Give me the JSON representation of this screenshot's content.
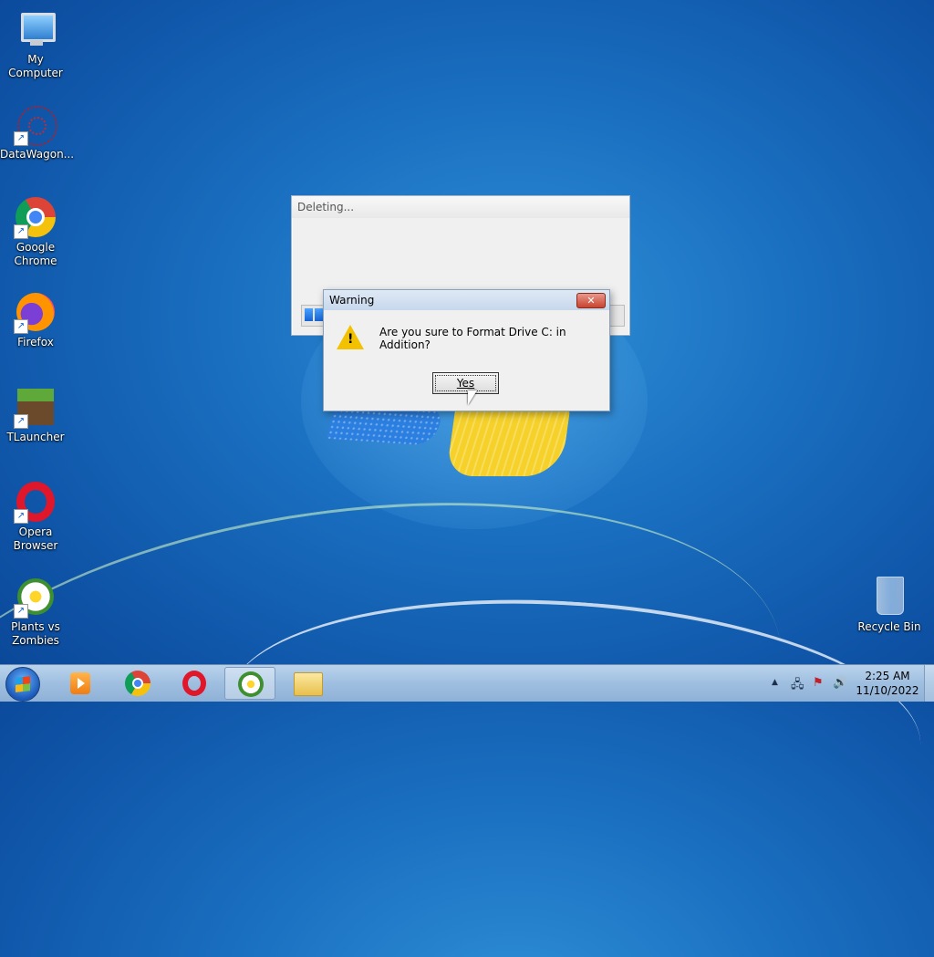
{
  "desktop": {
    "icons": [
      {
        "label": "My Computer",
        "icon": "computer-icon"
      },
      {
        "label": "DataWagon...",
        "icon": "datawagon-icon"
      },
      {
        "label": "Google Chrome",
        "icon": "chrome-icon"
      },
      {
        "label": "Firefox",
        "icon": "firefox-icon"
      },
      {
        "label": "TLauncher",
        "icon": "tlauncher-icon"
      },
      {
        "label": "Opera Browser",
        "icon": "opera-icon"
      },
      {
        "label": "Plants vs Zombies",
        "icon": "plants-vs-zombies-icon"
      }
    ],
    "recycle_bin": {
      "label": "Recycle Bin",
      "icon": "recycle-bin-icon"
    }
  },
  "deleting_window": {
    "title": "Deleting..."
  },
  "warning_dialog": {
    "title": "Warning",
    "close_label": "✕",
    "message": "Are you sure to Format Drive C: in Addition?",
    "yes_label": "Yes",
    "icon": "warning-icon"
  },
  "taskbar": {
    "items": [
      "windows-media-player-icon",
      "chrome-icon",
      "opera-icon",
      "plants-vs-zombies-icon",
      "folder-icon"
    ],
    "tray": {
      "chevron": "▲",
      "network": "🖧",
      "flag": "⚑",
      "volume": "🔊"
    },
    "clock": {
      "time": "2:25 AM",
      "date": "11/10/2022"
    }
  },
  "colors": {
    "desktop_blue": "#1a6fc0",
    "close_red": "#c8432e",
    "warning_yellow": "#f2c200",
    "progress_blue": "#1663d6"
  }
}
